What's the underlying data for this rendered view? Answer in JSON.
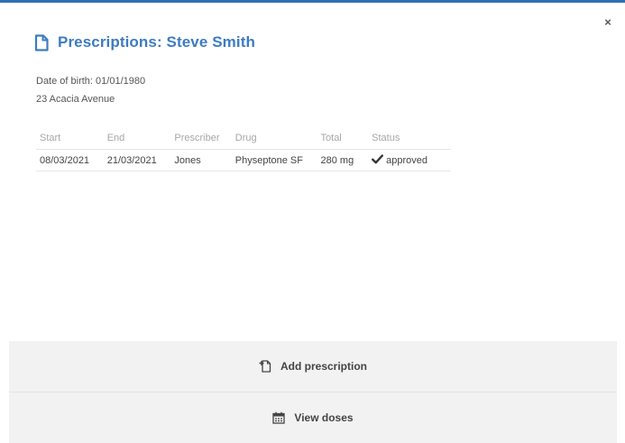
{
  "dialog": {
    "close_label": "×",
    "title": "Prescriptions: Steve Smith",
    "accent_color": "#3d7cc0"
  },
  "patient": {
    "dob_label": "Date of birth:",
    "dob_value": "01/01/1980",
    "address": "23 Acacia Avenue"
  },
  "table": {
    "columns": [
      "Start",
      "End",
      "Prescriber",
      "Drug",
      "Total",
      "Status"
    ],
    "rows": [
      {
        "start": "08/03/2021",
        "end": "21/03/2021",
        "prescriber": "Jones",
        "drug": "Physeptone SF",
        "total": "280 mg",
        "status": "approved",
        "status_icon": "check-icon"
      }
    ]
  },
  "actions": {
    "add_prescription": "Add prescription",
    "add_prescription_icon": "add-document-icon",
    "view_doses": "View doses",
    "view_doses_icon": "calendar-icon"
  }
}
